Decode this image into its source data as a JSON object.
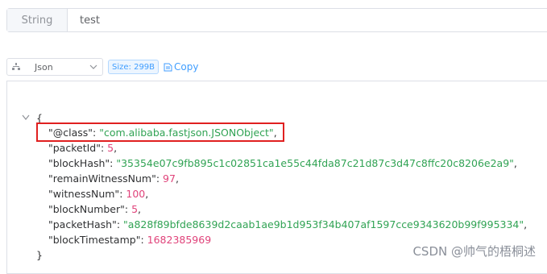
{
  "key_row": {
    "type_label": "String",
    "value": "test"
  },
  "toolbar": {
    "format_selected": "Json",
    "size_badge": "Size: 299B",
    "copy_label": "Copy"
  },
  "json_view": {
    "open_brace": "{",
    "close_brace": "}",
    "entries": [
      {
        "key": "\"@class\"",
        "value": "\"com.alibaba.fastjson.JSONObject\"",
        "type": "string"
      },
      {
        "key": "\"packetId\"",
        "value": "5",
        "type": "number"
      },
      {
        "key": "\"blockHash\"",
        "value": "\"35354e07c9fb895c1c02851ca1e55c44fda87c21d87c3d47c8ffc20c8206e2a9\"",
        "type": "string"
      },
      {
        "key": "\"remainWitnessNum\"",
        "value": "97",
        "type": "number"
      },
      {
        "key": "\"witnessNum\"",
        "value": "100",
        "type": "number"
      },
      {
        "key": "\"blockNumber\"",
        "value": "5",
        "type": "number"
      },
      {
        "key": "\"packetHash\"",
        "value": "\"a828f89bfde8639d2caab1ae9b1d953f34b407af1597cce9343620b99f995334\"",
        "type": "string"
      },
      {
        "key": "\"blockTimestamp\"",
        "value": "1682385969",
        "type": "number"
      }
    ]
  },
  "watermark": "CSDN @帅气的梧桐述",
  "colors": {
    "string_value": "#31a354",
    "number_value": "#e0437a",
    "accent": "#409eff",
    "highlight": "#e02020"
  }
}
